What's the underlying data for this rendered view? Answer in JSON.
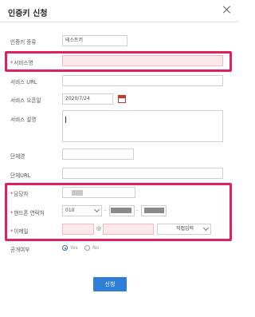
{
  "dialog": {
    "title": "인증키 신청"
  },
  "form": {
    "key_type": {
      "label": "인증키 종류",
      "value": "테스트키"
    },
    "service_name": {
      "label": "서비스명",
      "required": "*",
      "value": ""
    },
    "service_url": {
      "label": "서비스 URL",
      "value": ""
    },
    "service_open_date": {
      "label": "서비스 오픈일",
      "value": "2020/7/24"
    },
    "service_description": {
      "label": "서비스 설명",
      "value": ""
    },
    "org_name": {
      "label": "단체명",
      "value": ""
    },
    "org_url": {
      "label": "단체URL",
      "value": ""
    },
    "manager": {
      "label": "담당자",
      "required": "*",
      "value": ""
    },
    "phone": {
      "label": "핸드폰 연락처",
      "required": "*",
      "prefix": "010",
      "sep1": "-",
      "sep2": "-"
    },
    "email": {
      "label": "이메일",
      "required": "*",
      "at": "@",
      "domain_select": "직접입력"
    },
    "public": {
      "label": "공개여부",
      "yes": "Yes",
      "no": "No",
      "selected": "Yes"
    }
  },
  "actions": {
    "submit": "신청"
  },
  "colors": {
    "highlight": "#e0215e",
    "primary": "#2f7fd8",
    "required": "#e0215e"
  }
}
